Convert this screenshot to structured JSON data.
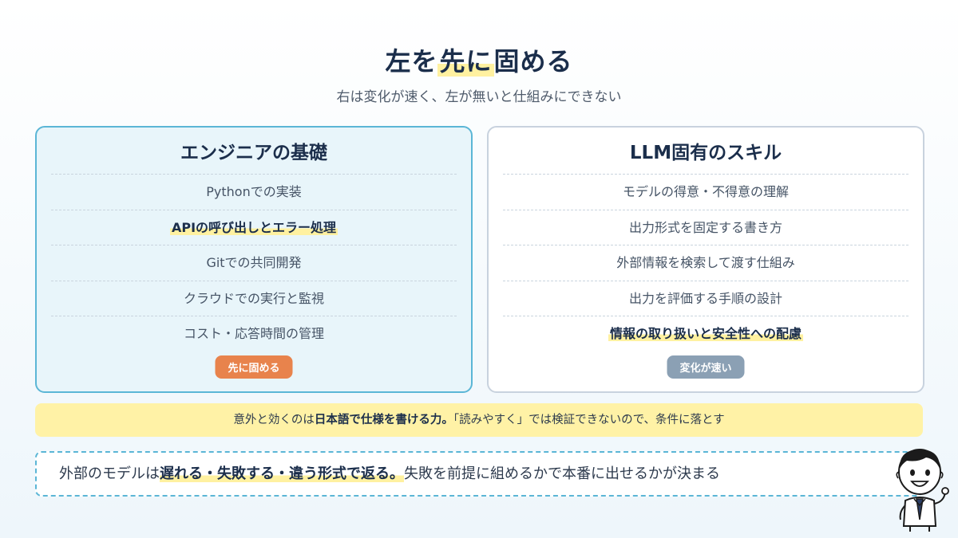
{
  "header": {
    "title_parts": [
      "左を",
      "先に",
      "固める"
    ],
    "subtitle": "右は変化が速く、左が無いと仕組みにできない"
  },
  "left_card": {
    "title": "エンジニアの基礎",
    "items": [
      "Pythonでの実装",
      "APIの呼び出しとエラー処理",
      "Gitでの共同開発",
      "クラウドでの実行と監視",
      "コスト・応答時間の管理"
    ],
    "badge": "先に固める"
  },
  "right_card": {
    "title": "LLM固有のスキル",
    "items": [
      "モデルの得意・不得意の理解",
      "出力形式を固定する書き方",
      "外部情報を検索して渡す仕組み",
      "出力を評価する手順の設計",
      "情報の取り扱いと安全性への配慮"
    ],
    "badge": "変化が速い"
  },
  "note": {
    "prefix": "意外と効くのは",
    "bold": "日本語で仕様を書ける力。",
    "suffix": "「読みやすく」では検証できないので、条件に落とす"
  },
  "callout": {
    "prefix": "外部のモデルは",
    "bold": "遅れる・失敗する・違う形式で返る。",
    "suffix": "失敗を前提に組めるかで本番に出せるかが決まる"
  },
  "colors": {
    "left_border": "#5bb6d6",
    "left_bg": "#e8f5fa",
    "highlight": "#fff1a0",
    "note_bg": "#fff2a6",
    "badge_orange": "#e8834c",
    "badge_gray": "#8ba0b4"
  },
  "icons": {
    "mascot": "businessman-mascot-icon"
  }
}
